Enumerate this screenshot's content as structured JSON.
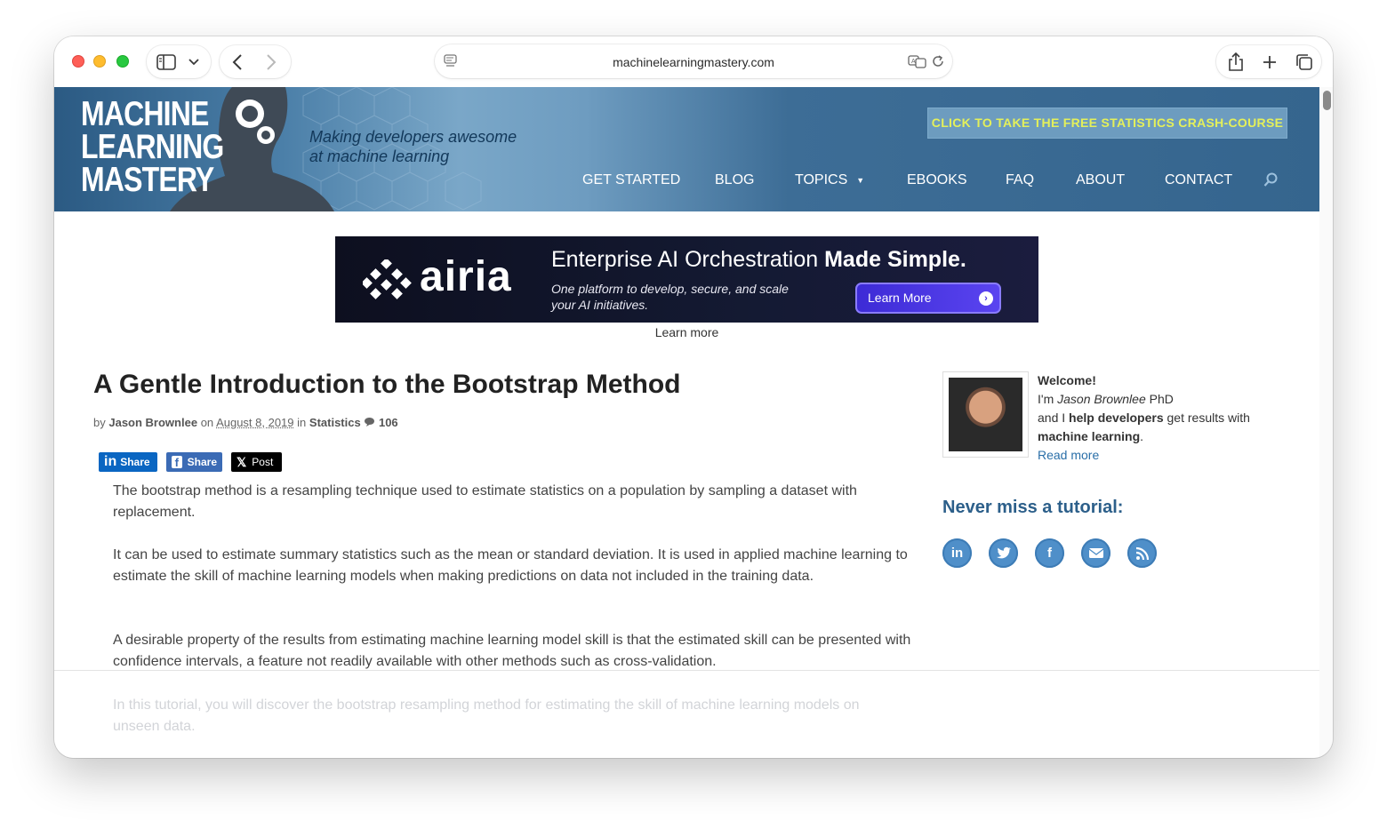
{
  "browser": {
    "url": "machinelearningmastery.com"
  },
  "header": {
    "logo_lines": [
      "MACHINE",
      "LEARNING",
      "MASTERY"
    ],
    "tagline_line1": "Making developers awesome",
    "tagline_line2": "at machine learning",
    "cta_label": "CLICK TO TAKE THE FREE STATISTICS CRASH-COURSE",
    "nav": [
      {
        "label": "GET STARTED"
      },
      {
        "label": "BLOG"
      },
      {
        "label": "TOPICS"
      },
      {
        "label": "EBOOKS"
      },
      {
        "label": "FAQ"
      },
      {
        "label": "ABOUT"
      },
      {
        "label": "CONTACT"
      }
    ]
  },
  "ad": {
    "logo": "airia",
    "title_regular": "Enterprise AI Orchestration ",
    "title_bold": "Made Simple.",
    "sub_line1": "One platform to develop, secure, and scale",
    "sub_line2": "your AI initiatives.",
    "button": "Learn More",
    "caption": "Learn more"
  },
  "article": {
    "title": "A Gentle Introduction to the Bootstrap Method",
    "meta_by": "by",
    "author": "Jason Brownlee",
    "meta_on": "on",
    "date": "August 8, 2019",
    "meta_in": "in",
    "category": "Statistics",
    "comments": "106",
    "share_linkedin": "Share",
    "share_facebook": "Share",
    "share_x": "Post",
    "paragraphs": [
      "The bootstrap method is a resampling technique used to estimate statistics on a population by sampling a dataset with replacement.",
      "It can be used to estimate summary statistics such as the mean or standard deviation. It is used in applied machine learning to estimate the skill of machine learning models when making predictions on data not included in the training data.",
      "A desirable property of the results from estimating machine learning model skill is that the estimated skill can be presented with confidence intervals, a feature not readily available with other methods such as cross-validation.",
      "In this tutorial, you will discover the bootstrap resampling method for estimating the skill of machine learning models on unseen data."
    ]
  },
  "sidebar": {
    "welcome": "Welcome!",
    "im": "I'm ",
    "name": "Jason Brownlee",
    "phd": " PhD",
    "and_i": "and I ",
    "help_devs": "help developers",
    "get_results": " get results with",
    "ml": "machine learning",
    "period": ".",
    "read_more": "Read more",
    "never_miss": "Never miss a tutorial:",
    "social_icons": [
      "linkedin-icon",
      "twitter-icon",
      "facebook-icon",
      "email-icon",
      "rss-icon"
    ]
  }
}
